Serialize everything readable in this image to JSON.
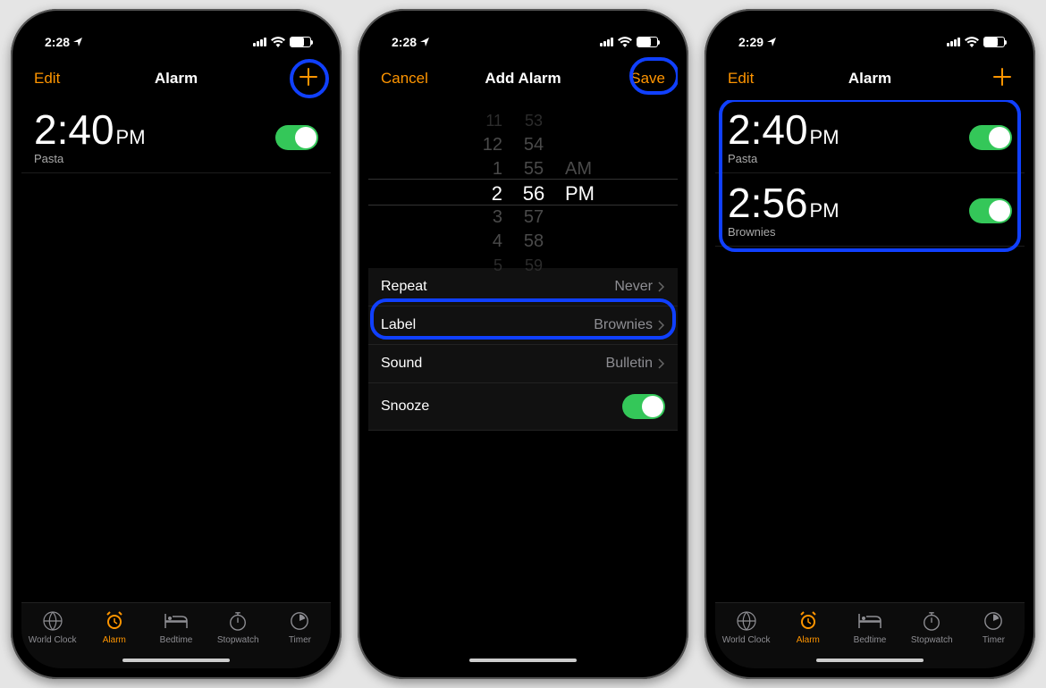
{
  "phones": [
    {
      "status_time": "2:28",
      "nav": {
        "left": "Edit",
        "title": "Alarm"
      },
      "alarms": [
        {
          "time": "2:40",
          "ampm": "PM",
          "label": "Pasta",
          "on": true
        }
      ],
      "tabs": [
        "World Clock",
        "Alarm",
        "Bedtime",
        "Stopwatch",
        "Timer"
      ],
      "active_tab": 1
    },
    {
      "status_time": "2:28",
      "nav": {
        "left": "Cancel",
        "title": "Add Alarm",
        "right": "Save"
      },
      "picker": {
        "hours": [
          "11",
          "12",
          "1",
          "2",
          "3",
          "4",
          "5"
        ],
        "minutes": [
          "53",
          "54",
          "55",
          "56",
          "57",
          "58",
          "59"
        ],
        "ampm": [
          "AM",
          "PM"
        ],
        "sel_hr": "2",
        "sel_mn": "56",
        "sel_ap": "PM"
      },
      "settings": {
        "repeat_l": "Repeat",
        "repeat_v": "Never",
        "label_l": "Label",
        "label_v": "Brownies",
        "sound_l": "Sound",
        "sound_v": "Bulletin",
        "snooze_l": "Snooze"
      }
    },
    {
      "status_time": "2:29",
      "nav": {
        "left": "Edit",
        "title": "Alarm"
      },
      "alarms": [
        {
          "time": "2:40",
          "ampm": "PM",
          "label": "Pasta",
          "on": true
        },
        {
          "time": "2:56",
          "ampm": "PM",
          "label": "Brownies",
          "on": true
        }
      ],
      "tabs": [
        "World Clock",
        "Alarm",
        "Bedtime",
        "Stopwatch",
        "Timer"
      ],
      "active_tab": 1
    }
  ]
}
